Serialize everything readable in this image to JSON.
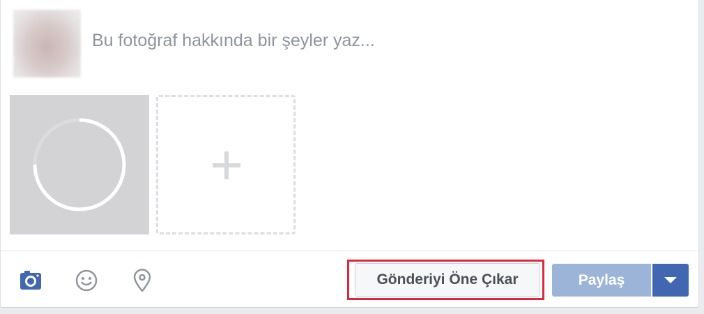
{
  "composer": {
    "caption_placeholder": "Bu fotoğraf hakkında bir şeyler yaz...",
    "upload_progress": 0.75
  },
  "toolbar": {
    "icons": [
      "camera-icon",
      "emoji-icon",
      "location-pin-icon"
    ],
    "boost_label": "Gönderiyi Öne Çıkar",
    "share_label": "Paylaş",
    "share_menu_icon": "caret-down-icon"
  },
  "colors": {
    "accent": "#4267b2",
    "share_disabled": "#9cb4d8",
    "highlight": "#e0263c"
  }
}
